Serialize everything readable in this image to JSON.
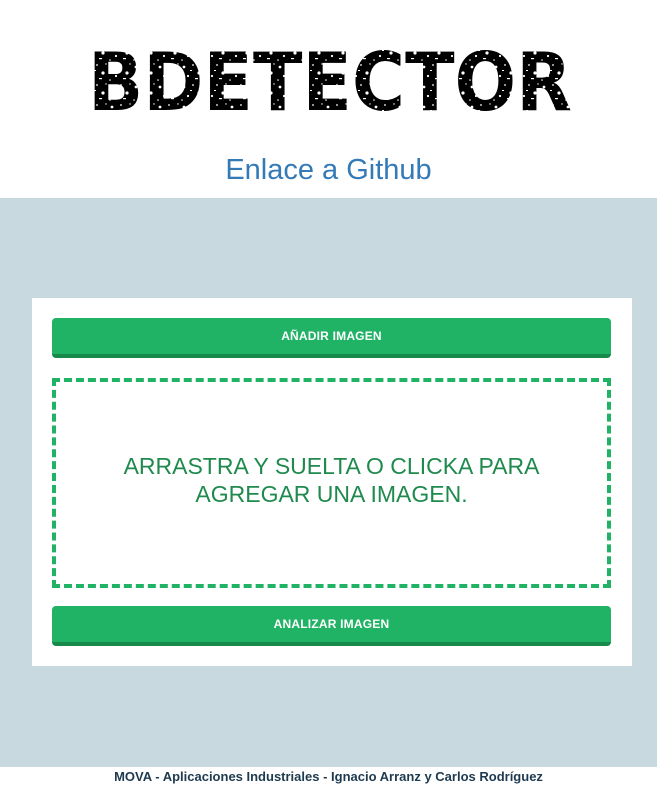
{
  "header": {
    "logo_text": "BDETECTOR",
    "github_link": "Enlace a Github",
    "link_color": "#337ab7"
  },
  "main": {
    "background_color": "#c8d9df",
    "add_image_button": "AÑADIR IMAGEN",
    "dropzone_text": "ARRASTRA Y SUELTA O CLICKA PARA AGREGAR UNA IMAGEN.",
    "analyze_button": "ANALIZAR IMAGEN",
    "accent_color": "#20b265"
  },
  "footer": {
    "text": "MOVA - Aplicaciones Industriales - Ignacio Arranz y Carlos Rodríguez"
  }
}
